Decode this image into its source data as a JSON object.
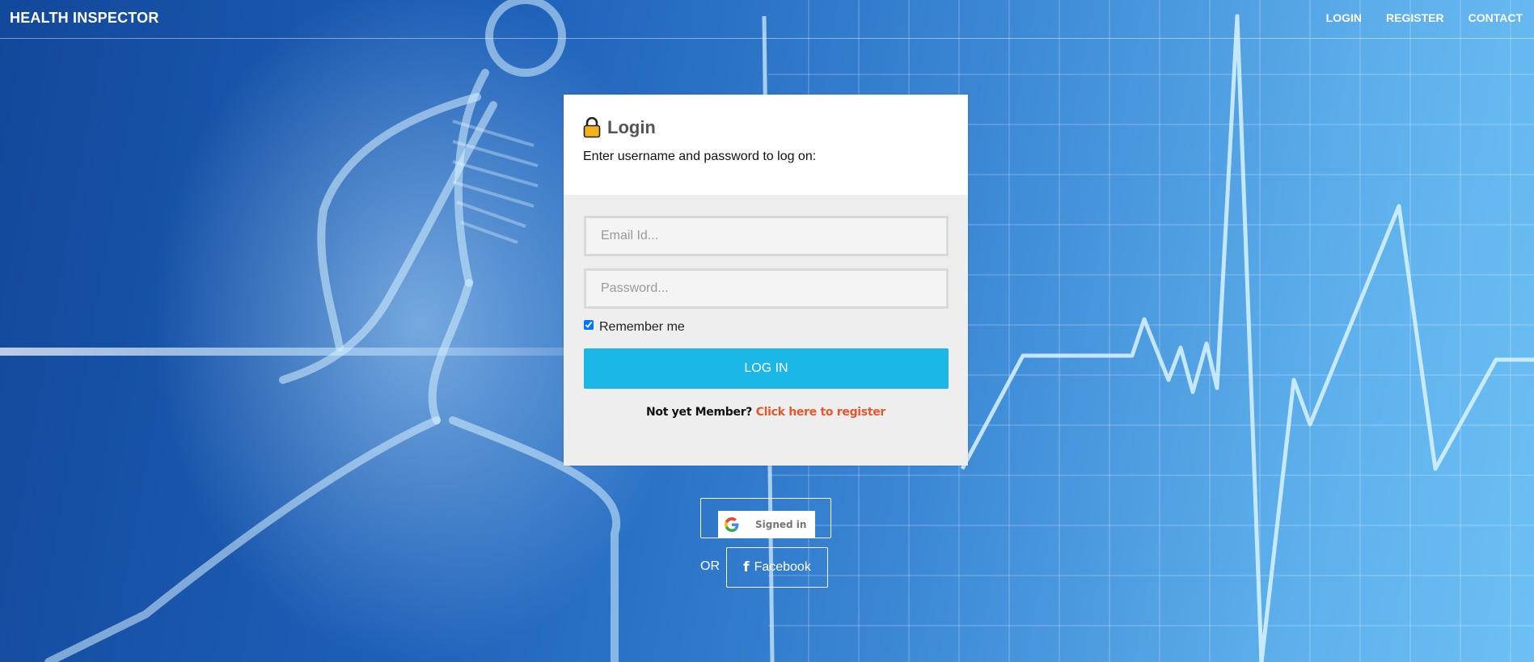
{
  "header": {
    "brand": "HEALTH INSPECTOR",
    "nav": [
      "LOGIN",
      "REGISTER",
      "CONTACT"
    ]
  },
  "login": {
    "title": "Login",
    "subtitle": "Enter username and password to log on:",
    "email_placeholder": "Email Id...",
    "password_placeholder": "Password...",
    "remember_label": "Remember me",
    "remember_checked": true,
    "submit_label": "LOG IN",
    "register_prompt": "Not yet Member?",
    "register_link": "Click here to register"
  },
  "social": {
    "google_label": "Signed in",
    "or_label": "OR",
    "facebook_label": "Facebook"
  },
  "icons": {
    "lock": "lock-icon",
    "google": "google-g-icon",
    "facebook": "facebook-f-icon"
  },
  "colors": {
    "accent": "#1bb7e6",
    "register_link": "#e8572a",
    "lock": "#f2b21c"
  }
}
